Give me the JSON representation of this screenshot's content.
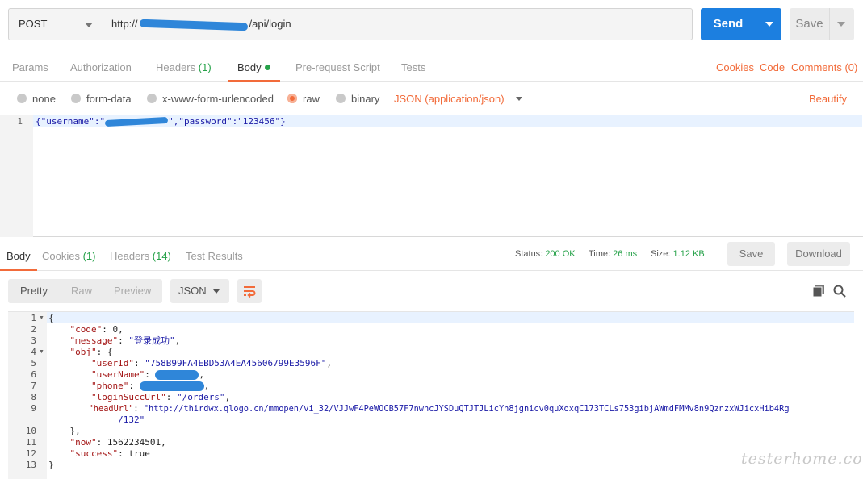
{
  "request": {
    "method": "POST",
    "url_prefix": "http://",
    "url_suffix": "/api/login",
    "send_label": "Send",
    "save_label": "Save"
  },
  "request_tabs": [
    {
      "label": "Params"
    },
    {
      "label": "Authorization"
    },
    {
      "label": "Headers",
      "count": "(1)"
    },
    {
      "label": "Body"
    },
    {
      "label": "Pre-request Script"
    },
    {
      "label": "Tests"
    }
  ],
  "request_links": {
    "cookies": "Cookies",
    "code": "Code",
    "comments": "Comments (0)"
  },
  "body_options": [
    "none",
    "form-data",
    "x-www-form-urlencoded",
    "raw",
    "binary"
  ],
  "body_type": "JSON (application/json)",
  "beautify_label": "Beautify",
  "request_body": {
    "line": "1",
    "p1": "{\"username\":\"",
    "p2": "\",\"password\":\"123456\"}"
  },
  "response_tabs": [
    {
      "label": "Body"
    },
    {
      "label": "Cookies",
      "count": "(1)"
    },
    {
      "label": "Headers",
      "count": "(14)"
    },
    {
      "label": "Test Results"
    }
  ],
  "response_meta": {
    "status_label": "Status:",
    "status": "200 OK",
    "time_label": "Time:",
    "time": "26 ms",
    "size_label": "Size:",
    "size": "1.12 KB"
  },
  "response_buttons": {
    "save": "Save",
    "download": "Download"
  },
  "view_modes": [
    "Pretty",
    "Raw",
    "Preview"
  ],
  "format": "JSON",
  "response_lines": [
    {
      "n": "1",
      "text": "{"
    },
    {
      "n": "2",
      "key": "\"code\"",
      "val": " 0,"
    },
    {
      "n": "3",
      "key": "\"message\"",
      "sval": "\"登录成功\"",
      "tail": ","
    },
    {
      "n": "4",
      "key": "\"obj\"",
      "val": " {"
    },
    {
      "n": "5",
      "key": "\"userId\"",
      "sval": "\"758B99FA4EBD53A4EA45606799E3596F\"",
      "tail": ","
    },
    {
      "n": "6",
      "key": "\"userName\"",
      "tail": ","
    },
    {
      "n": "7",
      "key": "\"phone\"",
      "tail": ","
    },
    {
      "n": "8",
      "key": "\"loginSuccUrl\"",
      "sval": "\"/orders\"",
      "tail": ","
    },
    {
      "n": "9",
      "key": "\"headUrl\"",
      "sval": "\"http://thirdwx.qlogo.cn/mmopen/vi_32/VJJwF4PeWOCB57F7nwhcJYSDuQTJTJLicYn8jgnicv0quXoxqC173TCLs753gibjAWmdFMMv8n9QznzxWJicxHib4Rg"
    },
    {
      "n": "",
      "sval": "/132\""
    },
    {
      "n": "10",
      "text": "},"
    },
    {
      "n": "11",
      "key": "\"now\"",
      "val": " 1562234501,"
    },
    {
      "n": "12",
      "key": "\"success\"",
      "val": " true"
    },
    {
      "n": "13",
      "text": "}"
    }
  ],
  "watermark": "testerhome.com",
  "colors": {
    "accent": "#f26b3a",
    "send": "#1c7fe0",
    "ok": "#27a24a",
    "string": "#1a1aa6",
    "key": "#a31515"
  }
}
